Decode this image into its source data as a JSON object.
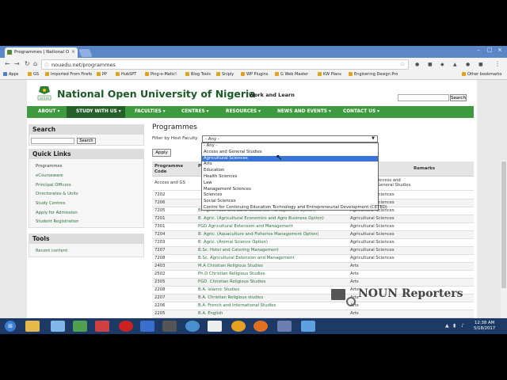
{
  "browser": {
    "tab_title": "Programmes | National O",
    "url": "nouedu.net/programmes",
    "bookmarks": [
      "Apps",
      "GS",
      "Imported From Firefo",
      "PP",
      "HubSPT",
      "Ping-o-Matic!",
      "Blog Tools",
      "Sniply",
      "WP Plugins",
      "G Web Master",
      "KW Plans",
      "Enginering Design Pro"
    ],
    "other_bookmarks": "Other bookmarks"
  },
  "site": {
    "name": "National Open University of Nigeria",
    "tagline": "Work and Learn",
    "logo_text": "NOUN",
    "search_button": "Search",
    "menu": [
      "ABOUT",
      "STUDY WITH US",
      "FACULTIES",
      "CENTRES",
      "RESOURCES",
      "NEWS AND EVENTS",
      "CONTACT US"
    ]
  },
  "sidebar": {
    "search_title": "Search",
    "search_button": "Search",
    "quicklinks_title": "Quick Links",
    "quicklinks": [
      "Programmes",
      "eCourseware",
      "Principal Officers",
      "Directorates & Units",
      "Study Centres",
      "Apply for Admission",
      "Student Registration"
    ],
    "tools_title": "Tools",
    "tools": [
      "Recent content"
    ]
  },
  "main": {
    "title": "Programmes",
    "filter_label": "Filter by Host Faculty",
    "filter_value": "- Any -",
    "apply": "Apply",
    "dropdown_options": [
      "- Any -",
      "Access and General Studies",
      "Agricultural Sciences",
      "Arts",
      "Education",
      "Health Sciences",
      "Law",
      "Management Sciences",
      "Sciences",
      "Social Sciences",
      "Centre for Continuing Education Technology and Entrepreneurial Development (CETED)"
    ],
    "selected_option": "Agricultural Sciences",
    "table": {
      "headers": [
        "Programme Code",
        "P",
        "Remarks"
      ],
      "first_row": {
        "code": "Access and GS",
        "faculty": "Access and General Studies"
      },
      "rows": [
        {
          "code": "7202",
          "name": "",
          "faculty": "Agricultural Sciences"
        },
        {
          "code": "7206",
          "name": "",
          "faculty": "Agricultural Sciences"
        },
        {
          "code": "7205",
          "name": "B. Agric. (Soil and Land Resources Management Option)",
          "faculty": "Agricultural Sciences"
        },
        {
          "code": "7201",
          "name": "B. Agric. (Agricultural Economics and Agro Business Option)",
          "faculty": "Agricultural Sciences"
        },
        {
          "code": "7301",
          "name": "PGD Agricultural Extension and Management",
          "faculty": "Agricultural Sciences"
        },
        {
          "code": "7204",
          "name": "B. Agric. (Aquaculture and Fisheries Management Option)",
          "faculty": "Agricultural Sciences"
        },
        {
          "code": "7203",
          "name": "B. Agric. (Animal Science Option)",
          "faculty": "Agricultural Sciences"
        },
        {
          "code": "7207",
          "name": "B.Sc. Hotel and Catering Management",
          "faculty": "Agricultural Sciences"
        },
        {
          "code": "7208",
          "name": "B.Sc. Agricultural Extension and Management",
          "faculty": "Agricultural Sciences"
        },
        {
          "code": "2403",
          "name": "M.A Christian Religious Studies",
          "faculty": "Arts"
        },
        {
          "code": "2502",
          "name": "Ph.D Christian Religious Studies",
          "faculty": "Arts"
        },
        {
          "code": "2305",
          "name": "PGD. Christian Religious Studies",
          "faculty": "Arts"
        },
        {
          "code": "2208",
          "name": "B.A. Islamic Studies",
          "faculty": "Arts"
        },
        {
          "code": "2207",
          "name": "B.A. Christian Religious studies",
          "faculty": "Arts"
        },
        {
          "code": "2206",
          "name": "B.A. French and International Studies",
          "faculty": "Arts"
        },
        {
          "code": "2205",
          "name": "B.A. English",
          "faculty": "Arts"
        }
      ]
    }
  },
  "watermark": "NOUN Reporters",
  "taskbar": {
    "time": "12:38 AM",
    "date": "5/18/2017"
  }
}
